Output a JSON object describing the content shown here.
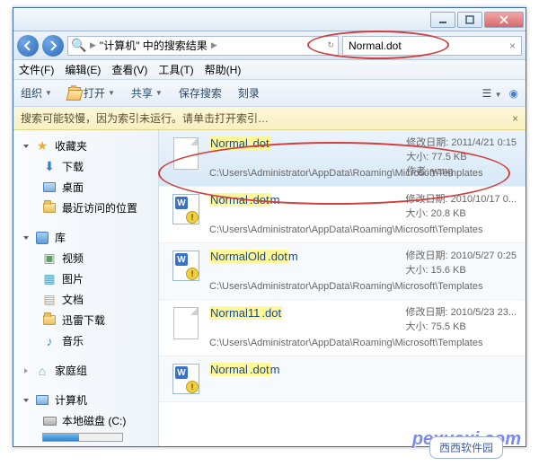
{
  "breadcrumb": {
    "locationPrefix": "\"",
    "location": "计算机",
    "locationSuffix": "\" 中的搜索结果"
  },
  "search": {
    "query": "Normal.dot"
  },
  "menu": {
    "file": "文件(F)",
    "edit": "编辑(E)",
    "view": "查看(V)",
    "tools": "工具(T)",
    "help": "帮助(H)"
  },
  "toolbar": {
    "organize": "组织",
    "open": "打开",
    "share": "共享",
    "saveSearch": "保存搜索",
    "burn": "刻录"
  },
  "warning": {
    "text": "搜索可能较慢，因为索引未运行。请单击打开索引…"
  },
  "labels": {
    "modDate": "修改日期:",
    "size": "大小:",
    "author": "作者:"
  },
  "nav": {
    "favorites": "收藏夹",
    "downloads": "下载",
    "desktop": "桌面",
    "recent": "最近访问的位置",
    "libraries": "库",
    "videos": "视频",
    "pictures": "图片",
    "documents": "文档",
    "xunlei": "迅雷下载",
    "music": "音乐",
    "homegroup": "家庭组",
    "computer": "计算机",
    "localdisk": "本地磁盘 (C:)"
  },
  "results": [
    {
      "pre": "Normal",
      "hl": ".dot",
      "post": "",
      "date": "2011/4/21 0:15",
      "size": "77.5 KB",
      "author": "yang",
      "path": "C:\\Users\\Administrator\\AppData\\Roaming\\Microsoft\\Templates",
      "icon": "doc",
      "sel": true
    },
    {
      "pre": "Normal",
      "hl": ".dot",
      "post": "m",
      "date": "2010/10/17 0...",
      "size": "20.8 KB",
      "author": "",
      "path": "C:\\Users\\Administrator\\AppData\\Roaming\\Microsoft\\Templates",
      "icon": "word",
      "sel": false
    },
    {
      "pre": "NormalOld",
      "hl": ".dot",
      "post": "m",
      "date": "2010/5/27 0:25",
      "size": "15.6 KB",
      "author": "",
      "path": "C:\\Users\\Administrator\\AppData\\Roaming\\Microsoft\\Templates",
      "icon": "word",
      "sel": false,
      "alt": true
    },
    {
      "pre": "Normal11",
      "hl": ".dot",
      "post": "",
      "date": "2010/5/23 23...",
      "size": "75.5 KB",
      "author": "",
      "path": "C:\\Users\\Administrator\\AppData\\Roaming\\Microsoft\\Templates",
      "icon": "doc",
      "sel": false
    },
    {
      "pre": "Normal",
      "hl": ".dot",
      "post": "m",
      "date": "",
      "size": "",
      "author": "",
      "path": "",
      "icon": "word",
      "sel": false,
      "alt": true
    }
  ],
  "watermark": "pexuexi.com",
  "bubble": "西西软件园"
}
